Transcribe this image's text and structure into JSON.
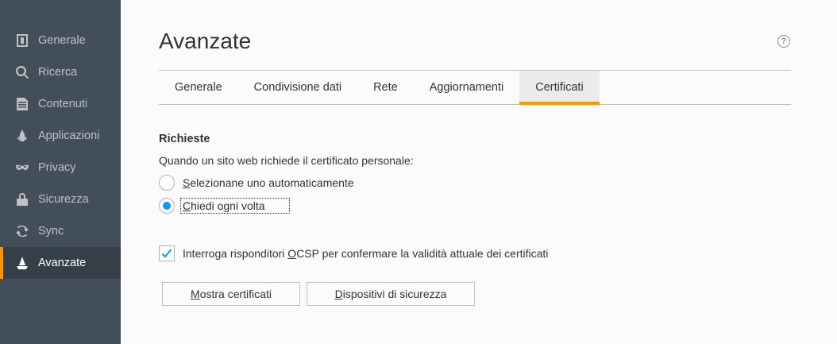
{
  "sidebar": {
    "items": [
      {
        "label": "Generale",
        "icon": "general-icon"
      },
      {
        "label": "Ricerca",
        "icon": "search-icon"
      },
      {
        "label": "Contenuti",
        "icon": "content-icon"
      },
      {
        "label": "Applicazioni",
        "icon": "applications-icon"
      },
      {
        "label": "Privacy",
        "icon": "privacy-mask-icon"
      },
      {
        "label": "Sicurezza",
        "icon": "security-icon"
      },
      {
        "label": "Sync",
        "icon": "sync-icon"
      },
      {
        "label": "Avanzate",
        "icon": "advanced-wizard-icon"
      }
    ],
    "active": "Avanzate"
  },
  "main": {
    "title": "Avanzate",
    "help": "?",
    "tabs": [
      {
        "label": "Generale"
      },
      {
        "label": "Condivisione dati"
      },
      {
        "label": "Rete"
      },
      {
        "label": "Aggiornamenti"
      },
      {
        "label": "Certificati"
      }
    ],
    "selected_tab": "Certificati",
    "requests": {
      "heading": "Richieste",
      "description": "Quando un sito web richiede il certificato personale:",
      "option_auto": {
        "access_key": "S",
        "rest": "elezionane uno automaticamente"
      },
      "option_ask": {
        "access_key": "C",
        "rest": "hiedi ogni volta"
      },
      "selected": "ask"
    },
    "ocsp": {
      "before": "Interroga risponditori ",
      "access_key": "O",
      "after": "CSP per confermare la validità attuale dei certificati",
      "checked": true
    },
    "buttons": {
      "show_certs": {
        "access_key": "M",
        "rest": "ostra certificati"
      },
      "security_devices": {
        "access_key": "D",
        "rest": "ispositivi di sicurezza"
      }
    }
  },
  "colors": {
    "sidebar_bg": "#424f5a",
    "sidebar_active_bg": "#343f48",
    "accent": "#ff9500",
    "radio_dot": "#0996f8",
    "check": "#0996f8"
  }
}
